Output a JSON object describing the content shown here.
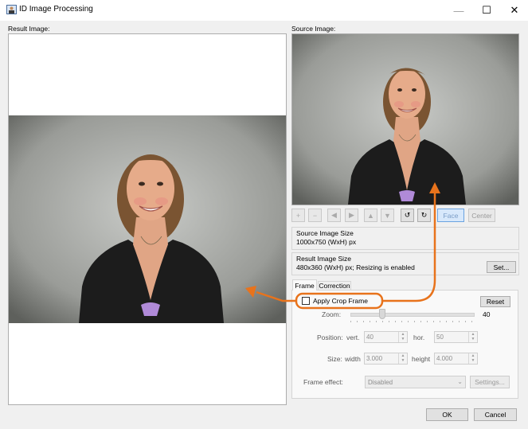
{
  "window": {
    "title": "ID Image Processing",
    "controls": {
      "minimize": "—",
      "maximize": "☐",
      "close": "✕"
    }
  },
  "result": {
    "label": "Result Image:"
  },
  "source": {
    "label": "Source Image:"
  },
  "toolbar": {
    "buttons": [
      {
        "name": "zoom-in-button",
        "glyph": "+"
      },
      {
        "name": "zoom-out-button",
        "glyph": "−"
      },
      {
        "name": "move-left-button",
        "glyph": "◀"
      },
      {
        "name": "move-right-button",
        "glyph": "▶"
      },
      {
        "name": "move-up-button",
        "glyph": "▲"
      },
      {
        "name": "move-down-button",
        "glyph": "▼"
      },
      {
        "name": "rotate-left-button",
        "glyph": "↺"
      },
      {
        "name": "rotate-right-button",
        "glyph": "↻"
      }
    ],
    "face_label": "Face",
    "center_label": "Center"
  },
  "source_size": {
    "title": "Source Image Size",
    "value": "1000x750 (WxH) px"
  },
  "result_size": {
    "title": "Result Image Size",
    "value": "480x360 (WxH) px; Resizing is enabled",
    "set_label": "Set..."
  },
  "tabs": [
    {
      "label": "Frame"
    },
    {
      "label": "Correction"
    }
  ],
  "frame": {
    "apply_crop_label": "Apply Crop Frame",
    "apply_crop_checked": false,
    "reset_label": "Reset",
    "zoom_label": "Zoom:",
    "zoom_value": "40",
    "position_label": "Position:",
    "vert_label": "vert.",
    "vert_value": "40",
    "hor_label": "hor.",
    "hor_value": "50",
    "size_label": "Size:",
    "width_label": "width",
    "width_value": "3.000",
    "height_label": "height",
    "height_value": "4.000",
    "effect_label": "Frame effect:",
    "effect_value": "Disabled",
    "settings_label": "Settings..."
  },
  "dialog": {
    "ok_label": "OK",
    "cancel_label": "Cancel"
  },
  "colors": {
    "accent_orange": "#e8731c",
    "window_bg": "#f0f0f0",
    "face_highlight": "#d7e8fb"
  }
}
